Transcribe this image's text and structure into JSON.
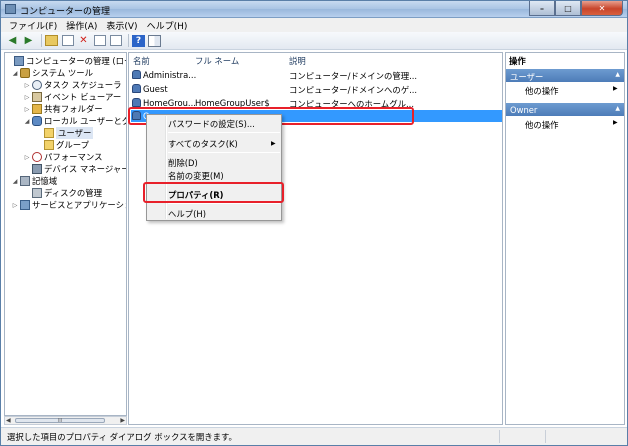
{
  "window": {
    "title": "コンピューターの管理"
  },
  "menu": [
    "ファイル(F)",
    "操作(A)",
    "表示(V)",
    "ヘルプ(H)"
  ],
  "tree": [
    {
      "label": "コンピューターの管理 (ローカ",
      "level": 0,
      "exp": "",
      "icon": "computer-icon"
    },
    {
      "label": "システム ツール",
      "level": 1,
      "exp": "◢",
      "icon": "tools-icon"
    },
    {
      "label": "タスク スケジューラ",
      "level": 2,
      "exp": "▷",
      "icon": "clock-icon"
    },
    {
      "label": "イベント ビューアー",
      "level": 2,
      "exp": "▷",
      "icon": "event-viewer-icon"
    },
    {
      "label": "共有フォルダー",
      "level": 2,
      "exp": "▷",
      "icon": "shared-folder-icon"
    },
    {
      "label": "ローカル ユーザーとグ",
      "level": 2,
      "exp": "◢",
      "icon": "users-icon"
    },
    {
      "label": "ユーザー",
      "level": 3,
      "exp": "",
      "icon": "folder-icon"
    },
    {
      "label": "グループ",
      "level": 3,
      "exp": "",
      "icon": "folder-icon"
    },
    {
      "label": "パフォーマンス",
      "level": 2,
      "exp": "▷",
      "icon": "performance-icon"
    },
    {
      "label": "デバイス マネージャー",
      "level": 2,
      "exp": "",
      "icon": "device-manager-icon"
    },
    {
      "label": "記憶域",
      "level": 1,
      "exp": "◢",
      "icon": "storage-icon"
    },
    {
      "label": "ディスクの管理",
      "level": 2,
      "exp": "",
      "icon": "disk-icon"
    },
    {
      "label": "サービスとアプリケーショ",
      "level": 1,
      "exp": "▷",
      "icon": "services-icon"
    }
  ],
  "tree_scroll_label": "III",
  "columns": [
    "名前",
    "フル ネーム",
    "説明"
  ],
  "users": [
    {
      "name": "Administra...",
      "fullname": "",
      "desc": "コンピューター/ドメインの管理..."
    },
    {
      "name": "Guest",
      "fullname": "",
      "desc": "コンピューター/ドメインへのゲ..."
    },
    {
      "name": "HomeGrou...",
      "fullname": "HomeGroupUser$",
      "desc": "コンピューターへのホームグル..."
    },
    {
      "name": "O...",
      "fullname": "",
      "desc": ""
    }
  ],
  "context_menu": {
    "set_password": "パスワードの設定(S)...",
    "all_tasks": "すべてのタスク(K)",
    "all_tasks_arrow": "▶",
    "delete": "削除(D)",
    "rename": "名前の変更(M)",
    "properties": "プロパティ(R)",
    "help": "ヘルプ(H)"
  },
  "actions": {
    "title": "操作",
    "section1": "ユーザー",
    "section1_item": "他の操作",
    "section2": "Owner",
    "section2_item": "他の操作",
    "collapse_glyph": "▲",
    "more_glyph": "▶"
  },
  "status": "選択した項目のプロパティ ダイアログ ボックスを開きます。",
  "colors": {
    "selection": "#3399ff",
    "highlight_box": "#e8202a",
    "action_header": "#5a88c2"
  }
}
